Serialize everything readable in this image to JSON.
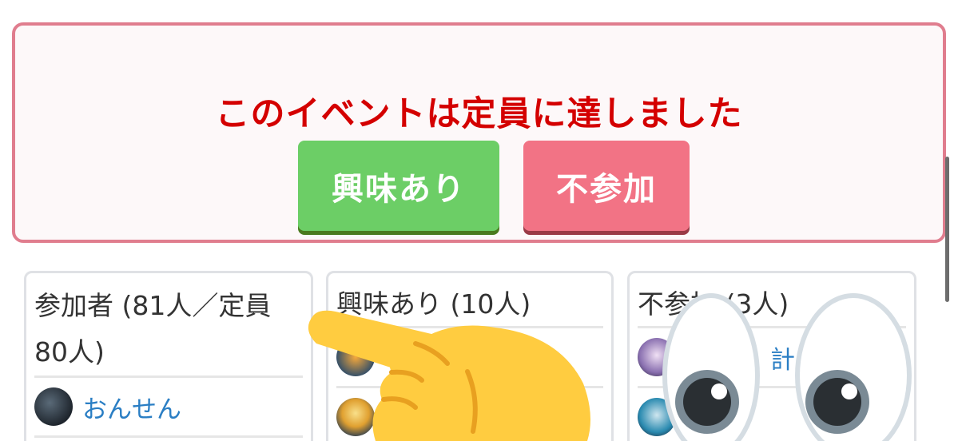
{
  "notice": {
    "title": "このイベントは定員に達しました",
    "interest_button": "興味あり",
    "decline_button": "不参加"
  },
  "columns": [
    {
      "heading": "参加者 (81人／定員80人)",
      "members": [
        {
          "name": "おんせん",
          "avatar": "dark-feathers-avatar"
        }
      ]
    },
    {
      "heading": "興味あり (10人)",
      "members": [
        {
          "name": "",
          "avatar": "orange-avatar"
        },
        {
          "name": "",
          "avatar": "blond-character-avatar"
        }
      ]
    },
    {
      "heading": "不参加 (3人)",
      "members": [
        {
          "name": "計",
          "avatar": "purple-character-avatar"
        },
        {
          "name": "",
          "avatar": "teal-character-avatar"
        }
      ]
    }
  ],
  "colors": {
    "notice_border": "#e07d8e",
    "notice_title": "#d40000",
    "interest_button": "#6cce66",
    "decline_button": "#f27385",
    "link": "#2a7ec4"
  },
  "overlays": [
    "pointing-hand-emoji",
    "eyes-emoji"
  ]
}
